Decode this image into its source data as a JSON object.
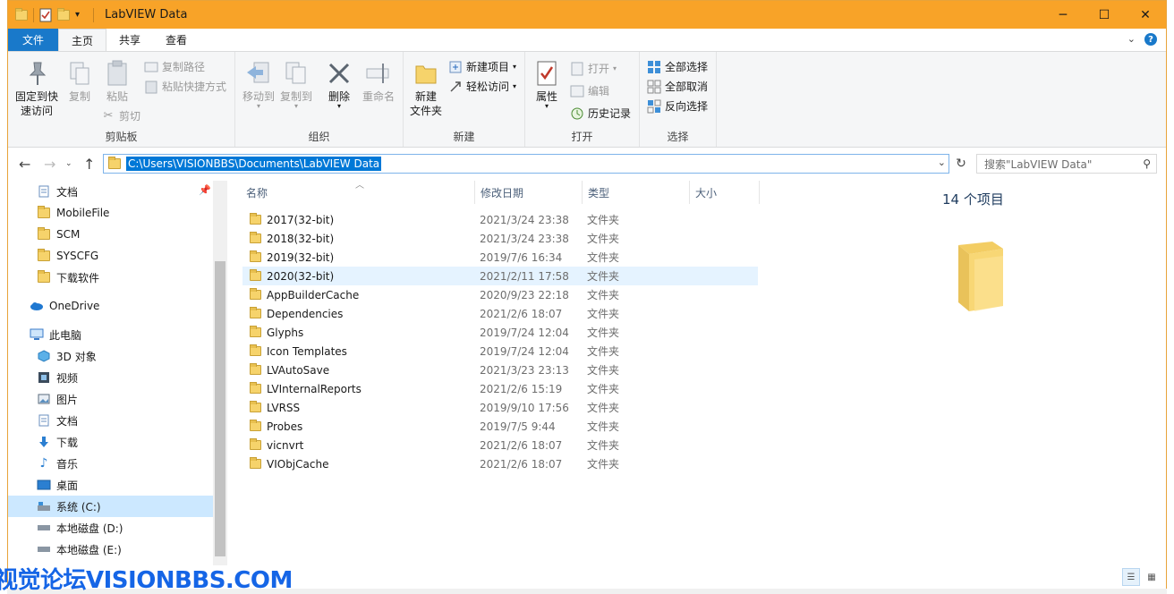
{
  "window": {
    "title": "LabVIEW Data",
    "minimize": "─",
    "maximize": "☐",
    "close": "✕"
  },
  "tabs": [
    {
      "label": "文件"
    },
    {
      "label": "主页"
    },
    {
      "label": "共享"
    },
    {
      "label": "查看"
    }
  ],
  "ribbon": {
    "clipboard": {
      "label": "剪贴板",
      "pin_quick": "固定到快\n速访问",
      "copy": "复制",
      "paste": "粘贴",
      "copy_path": "复制路径",
      "paste_shortcut": "粘贴快捷方式",
      "cut": "剪切"
    },
    "organize": {
      "label": "组织",
      "move_to": "移动到",
      "copy_to": "复制到",
      "delete": "删除",
      "rename": "重命名"
    },
    "new": {
      "label": "新建",
      "new_folder": "新建\n文件夹",
      "new_item": "新建项目",
      "easy_access": "轻松访问"
    },
    "open": {
      "label": "打开",
      "properties": "属性",
      "open": "打开",
      "edit": "编辑",
      "history": "历史记录"
    },
    "select": {
      "label": "选择",
      "select_all": "全部选择",
      "select_none": "全部取消",
      "invert": "反向选择"
    }
  },
  "address": {
    "path": "C:\\Users\\VISIONBBS\\Documents\\LabVIEW Data",
    "search_placeholder": "搜索\"LabVIEW Data\""
  },
  "nav_pane": {
    "items": [
      {
        "label": "文档",
        "icon": "document-icon"
      },
      {
        "label": "MobileFile",
        "icon": "folder-icon"
      },
      {
        "label": "SCM",
        "icon": "folder-icon"
      },
      {
        "label": "SYSCFG",
        "icon": "folder-icon"
      },
      {
        "label": "下载软件",
        "icon": "folder-icon"
      },
      {
        "label": "OneDrive",
        "icon": "cloud-icon"
      },
      {
        "label": "此电脑",
        "icon": "computer-icon"
      },
      {
        "label": "3D 对象",
        "icon": "cube-icon"
      },
      {
        "label": "视频",
        "icon": "video-icon"
      },
      {
        "label": "图片",
        "icon": "picture-icon"
      },
      {
        "label": "文档",
        "icon": "document-icon"
      },
      {
        "label": "下载",
        "icon": "download-icon"
      },
      {
        "label": "音乐",
        "icon": "music-icon"
      },
      {
        "label": "桌面",
        "icon": "desktop-icon"
      },
      {
        "label": "系统 (C:)",
        "icon": "drive-icon"
      },
      {
        "label": "本地磁盘 (D:)",
        "icon": "drive-icon"
      },
      {
        "label": "本地磁盘 (E:)",
        "icon": "drive-icon"
      }
    ]
  },
  "columns": {
    "name": "名称",
    "date": "修改日期",
    "type": "类型",
    "size": "大小"
  },
  "files": [
    {
      "name": "2017(32-bit)",
      "date": "2021/3/24 23:38",
      "type": "文件夹"
    },
    {
      "name": "2018(32-bit)",
      "date": "2021/3/24 23:38",
      "type": "文件夹"
    },
    {
      "name": "2019(32-bit)",
      "date": "2019/7/6 16:34",
      "type": "文件夹"
    },
    {
      "name": "2020(32-bit)",
      "date": "2021/2/11 17:58",
      "type": "文件夹"
    },
    {
      "name": "AppBuilderCache",
      "date": "2020/9/23 22:18",
      "type": "文件夹"
    },
    {
      "name": "Dependencies",
      "date": "2021/2/6 18:07",
      "type": "文件夹"
    },
    {
      "name": "Glyphs",
      "date": "2019/7/24 12:04",
      "type": "文件夹"
    },
    {
      "name": "Icon Templates",
      "date": "2019/7/24 12:04",
      "type": "文件夹"
    },
    {
      "name": "LVAutoSave",
      "date": "2021/3/23 23:13",
      "type": "文件夹"
    },
    {
      "name": "LVInternalReports",
      "date": "2021/2/6 15:19",
      "type": "文件夹"
    },
    {
      "name": "LVRSS",
      "date": "2019/9/10 17:56",
      "type": "文件夹"
    },
    {
      "name": "Probes",
      "date": "2019/7/5 9:44",
      "type": "文件夹"
    },
    {
      "name": "vicnvrt",
      "date": "2021/2/6 18:07",
      "type": "文件夹"
    },
    {
      "name": "VIObjCache",
      "date": "2021/2/6 18:07",
      "type": "文件夹"
    }
  ],
  "preview": {
    "count": "14 个项目"
  },
  "watermark": "视觉论坛VISIONBBS.COM",
  "colors": {
    "titlebar": "#f8a328",
    "accent": "#1979ca",
    "selection": "#0078d7",
    "watermark": "#1565e6"
  }
}
